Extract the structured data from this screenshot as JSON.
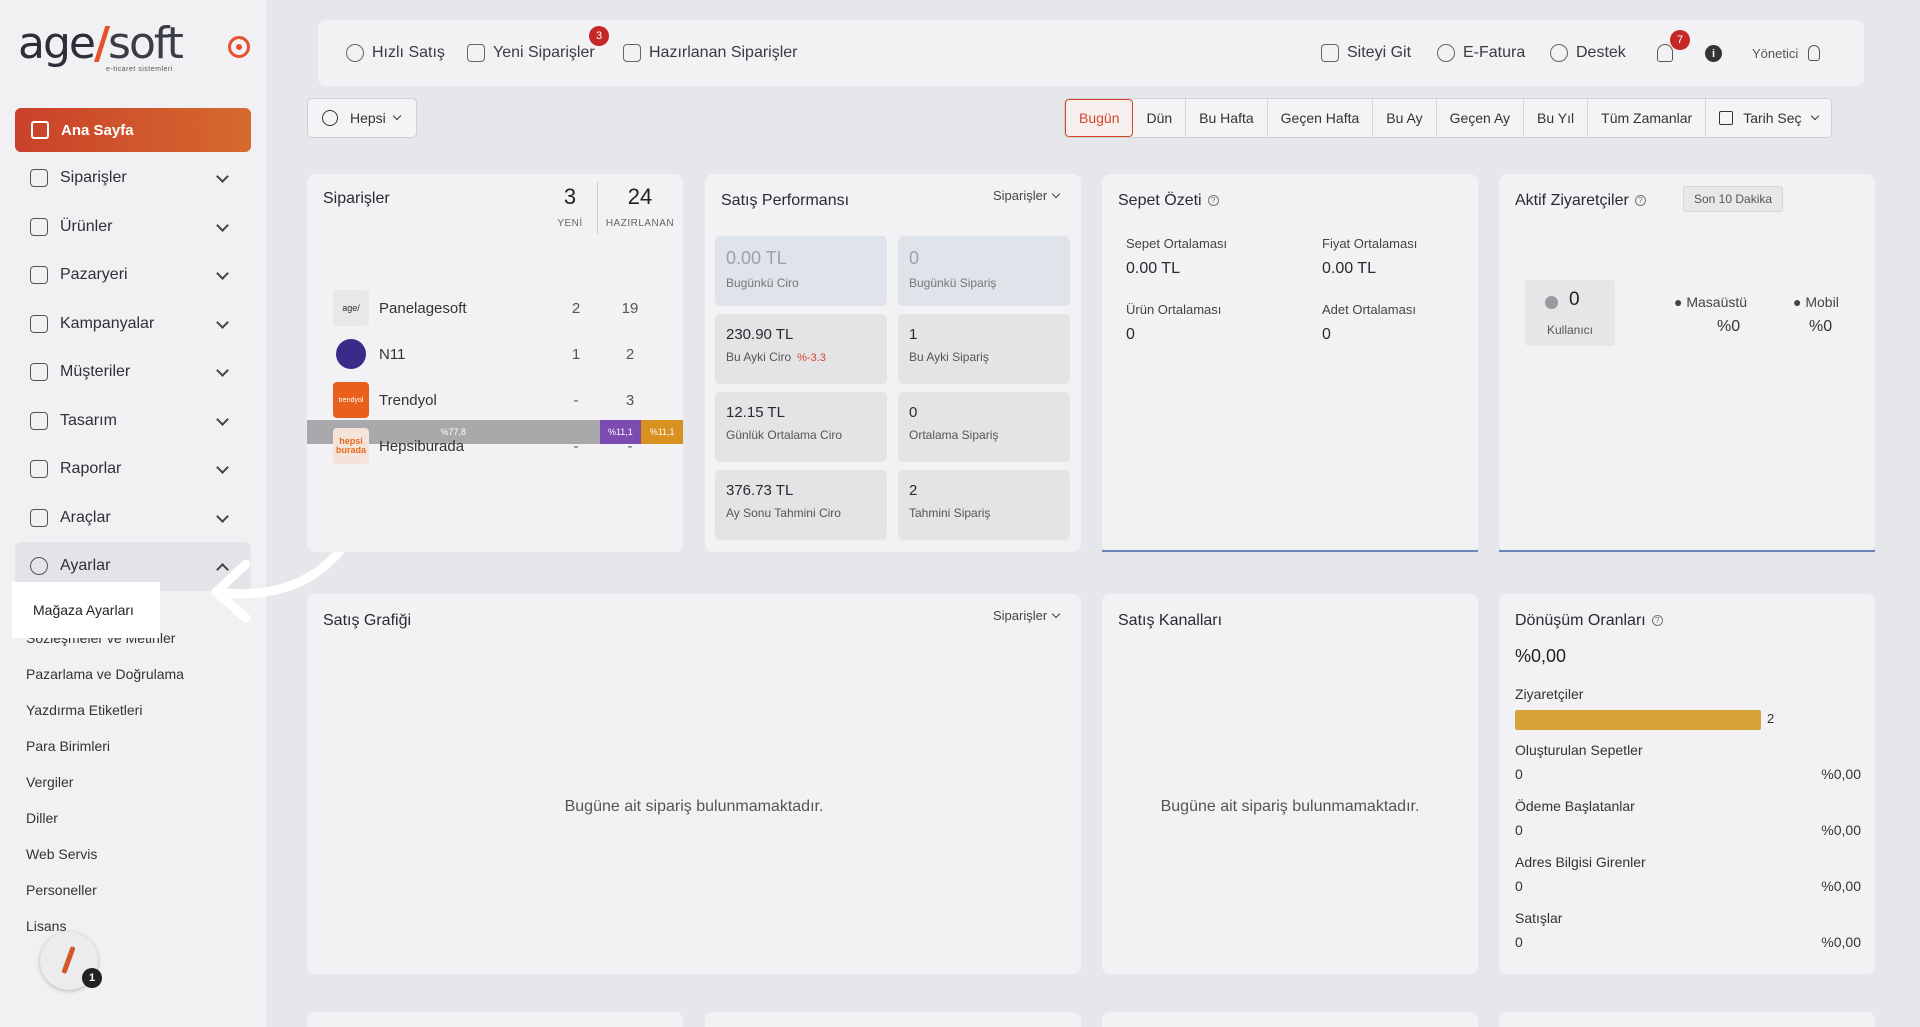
{
  "logo": {
    "main_left": "age",
    "main_slash": "/",
    "main_right": "soft",
    "tagline": "e-ticaret sistemleri"
  },
  "sidebar": {
    "home_label": "Ana Sayfa",
    "items": [
      {
        "label": "Siparişler",
        "icon": "cart-icon"
      },
      {
        "label": "Ürünler",
        "icon": "book-icon"
      },
      {
        "label": "Pazaryeri",
        "icon": "box-icon"
      },
      {
        "label": "Kampanyalar",
        "icon": "gift-icon"
      },
      {
        "label": "Müşteriler",
        "icon": "user-icon"
      },
      {
        "label": "Tasarım",
        "icon": "pen-icon"
      },
      {
        "label": "Raporlar",
        "icon": "chart-icon"
      },
      {
        "label": "Araçlar",
        "icon": "clipboard-icon"
      },
      {
        "label": "Ayarlar",
        "icon": "gear-icon"
      }
    ],
    "sub_items": [
      "Sözleşmeler ve Metinler",
      "Pazarlama ve Doğrulama",
      "Yazdırma Etiketleri",
      "Para Birimleri",
      "Vergiler",
      "Diller",
      "Web Servis",
      "Personeller",
      "Lisans"
    ],
    "highlight_label": "Mağaza Ayarları",
    "fab_badge": "1"
  },
  "topbar": {
    "quick_sale": "Hızlı Satış",
    "new_orders": "Yeni Siparişler",
    "new_orders_badge": "3",
    "prepared_orders": "Hazırlanan Siparişler",
    "go_site": "Siteyi Git",
    "einvoice": "E-Fatura",
    "support": "Destek",
    "notif_badge": "7",
    "info": "i",
    "user": "Yönetici"
  },
  "filter": {
    "store": "Hepsi"
  },
  "ranges": [
    "Bugün",
    "Dün",
    "Bu Hafta",
    "Geçen Hafta",
    "Bu Ay",
    "Geçen Ay",
    "Bu Yıl",
    "Tüm Zamanlar",
    "Tarih Seç"
  ],
  "orders_card": {
    "title": "Siparişler",
    "new_count": "3",
    "new_label": "YENİ",
    "prep_count": "24",
    "prep_label": "HAZIRLANAN",
    "bar": [
      {
        "label": "%77,8",
        "percent": 77.8,
        "color": "#a9a9ac"
      },
      {
        "label": "%11,1",
        "percent": 11.1,
        "color": "#7b4bb0"
      },
      {
        "label": "%11,1",
        "percent": 11.1,
        "color": "#d9911f"
      }
    ],
    "channels": [
      {
        "name": "Panelagesoft",
        "a": "2",
        "b": "19",
        "logo": "agesoft-logo"
      },
      {
        "name": "N11",
        "a": "1",
        "b": "2",
        "logo": "n11-logo"
      },
      {
        "name": "Trendyol",
        "a": "-",
        "b": "3",
        "logo": "trendyol-logo",
        "logo_text": "trendyol"
      },
      {
        "name": "Hepsiburada",
        "a": "-",
        "b": "-",
        "logo": "hepsiburada-logo",
        "logo_text": "hepsi burada"
      }
    ]
  },
  "performance": {
    "title": "Satış Performansı",
    "dropdown": "Siparişler",
    "boxes": [
      {
        "value": "0.00 TL",
        "label": "Bugünkü Ciro"
      },
      {
        "value": "0",
        "label": "Bugünkü Sipariş"
      },
      {
        "value": "230.90 TL",
        "label": "Bu Ayki Ciro",
        "delta": "%-3.3"
      },
      {
        "value": "1",
        "label": "Bu Ayki Sipariş"
      },
      {
        "value": "12.15 TL",
        "label": "Günlük Ortalama Ciro"
      },
      {
        "value": "0",
        "label": "Ortalama Sipariş"
      },
      {
        "value": "376.73 TL",
        "label": "Ay Sonu Tahmini Ciro"
      },
      {
        "value": "2",
        "label": "Tahmini Sipariş"
      }
    ]
  },
  "cart_summary": {
    "title": "Sepet Özeti",
    "basket_avg_label": "Sepet Ortalaması",
    "basket_avg": "0.00 TL",
    "price_avg_label": "Fiyat Ortalaması",
    "price_avg": "0.00 TL",
    "product_avg_label": "Ürün Ortalaması",
    "product_avg": "0",
    "qty_avg_label": "Adet Ortalaması",
    "qty_avg": "0"
  },
  "visitors": {
    "title": "Aktif Ziyaretçiler",
    "range_tag": "Son 10 Dakika",
    "users": "0",
    "users_label": "Kullanıcı",
    "desktop_label": "Masaüstü",
    "desktop": "%0",
    "mobile_label": "Mobil",
    "mobile": "%0"
  },
  "sales_chart": {
    "title": "Satış Grafiği",
    "dropdown": "Siparişler",
    "empty": "Bugüne ait sipariş bulunmamaktadır."
  },
  "sales_channels": {
    "title": "Satış Kanalları",
    "empty": "Bugüne ait sipariş bulunmamaktadır."
  },
  "conversion": {
    "title": "Dönüşüm Oranları",
    "rate": "%0,00",
    "visitors_label": "Ziyaretçiler",
    "visitors_value": "2",
    "rows": [
      {
        "label": "Oluşturulan Sepetler",
        "count": "0",
        "pct": "%0,00"
      },
      {
        "label": "Ödeme Başlatanlar",
        "count": "0",
        "pct": "%0,00"
      },
      {
        "label": "Adres Bilgisi Girenler",
        "count": "0",
        "pct": "%0,00"
      },
      {
        "label": "Satışlar",
        "count": "0",
        "pct": "%0,00"
      }
    ]
  },
  "colors": {
    "accent": "#d6452c",
    "sidebar_bg": "#f1f1f3",
    "page_bg": "#e6e7ea"
  }
}
